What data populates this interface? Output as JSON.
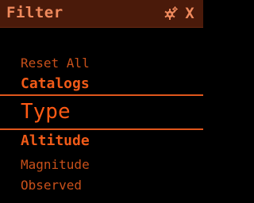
{
  "window": {
    "title": "Filter",
    "close_label": "X"
  },
  "icons": {
    "settings": "gear-icon",
    "close": "close-icon"
  },
  "menu": {
    "items": [
      {
        "label": "Reset All",
        "selected": false
      },
      {
        "label": "Catalogs",
        "selected": false
      },
      {
        "label": "Type",
        "selected": true
      },
      {
        "label": "Altitude",
        "selected": false
      },
      {
        "label": "Magnitude",
        "selected": false
      },
      {
        "label": "Observed",
        "selected": false
      }
    ]
  },
  "colors": {
    "background": "#000000",
    "titlebar": "#4a1a0a",
    "title_text": "#f08a5d",
    "item_text": "#c8501a",
    "accent": "#ff5a14",
    "selection_line": "#e0561c"
  }
}
